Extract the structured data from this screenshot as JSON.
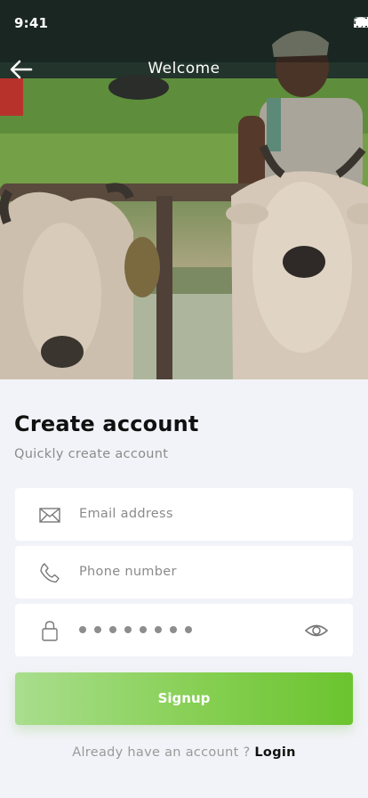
{
  "status": {
    "time": "9:41"
  },
  "header": {
    "title": "Welcome"
  },
  "form": {
    "title": "Create account",
    "subtitle": "Quickly create account",
    "email_placeholder": "Email address",
    "phone_placeholder": "Phone number",
    "password_masked_count": 8,
    "signup_label": "Signup"
  },
  "footer": {
    "prompt": "Already have an account ?",
    "login_label": "Login"
  },
  "colors": {
    "background": "#f2f3f8",
    "button_gradient_start": "#a9de8e",
    "button_gradient_end": "#6bc42e",
    "title_text": "#111111",
    "muted_text": "#8b8b8b"
  },
  "icons": [
    "back-arrow-icon",
    "signal-icon",
    "wifi-icon",
    "battery-icon",
    "mail-icon",
    "phone-icon",
    "lock-icon",
    "eye-icon"
  ]
}
